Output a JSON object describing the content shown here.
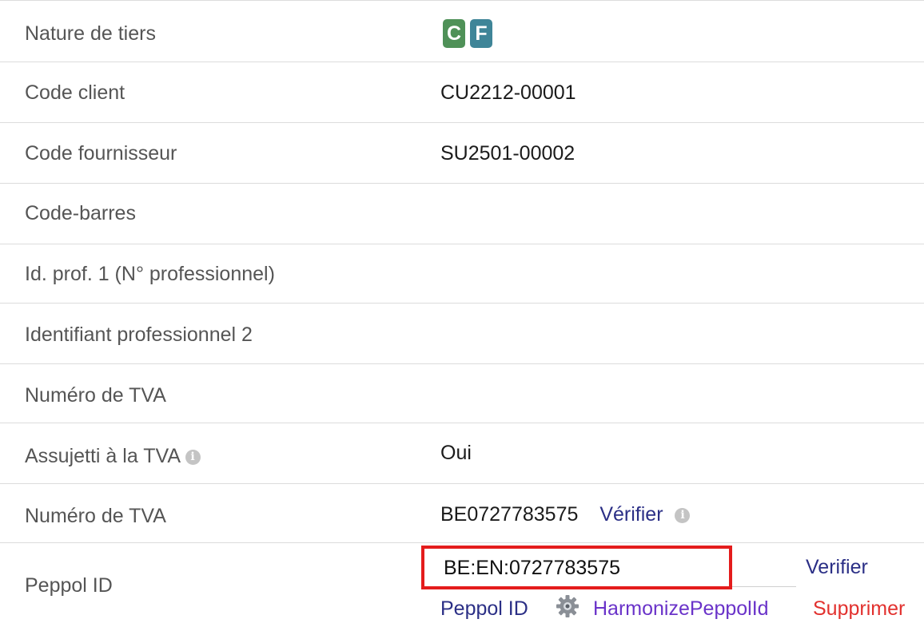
{
  "rows": [
    {
      "label": "Nature de tiers",
      "badges": [
        "C",
        "F"
      ]
    },
    {
      "label": "Code client",
      "value": "CU2212-00001"
    },
    {
      "label": "Code fournisseur",
      "value": "SU2501-00002"
    },
    {
      "label": "Code-barres",
      "value": ""
    },
    {
      "label": "Id. prof. 1 (N° professionnel)",
      "value": ""
    },
    {
      "label": "Identifiant professionnel 2",
      "value": ""
    },
    {
      "label": "Numéro de TVA",
      "value": ""
    },
    {
      "label": "Assujetti à la TVA",
      "value": "Oui"
    },
    {
      "label": "Numéro de TVA",
      "value": "BE0727783575",
      "link": "Vérifier"
    },
    {
      "label": "Peppol ID",
      "input_value": "BE:EN:0727783575",
      "verify_link": "Verifier"
    }
  ],
  "peppol_actions": {
    "peppol_id_link": "Peppol ID",
    "harmonize_link": "HarmonizePeppolId",
    "delete_link": "Supprimer"
  },
  "colors": {
    "badge_c": "#4f9158",
    "badge_f": "#3f8598",
    "link": "#2b2f86",
    "harmonize": "#6a33c9",
    "delete": "#e2312e",
    "highlight_border": "#e41c1c"
  },
  "icons": {
    "info": "info-icon",
    "gear": "gear-icon"
  }
}
